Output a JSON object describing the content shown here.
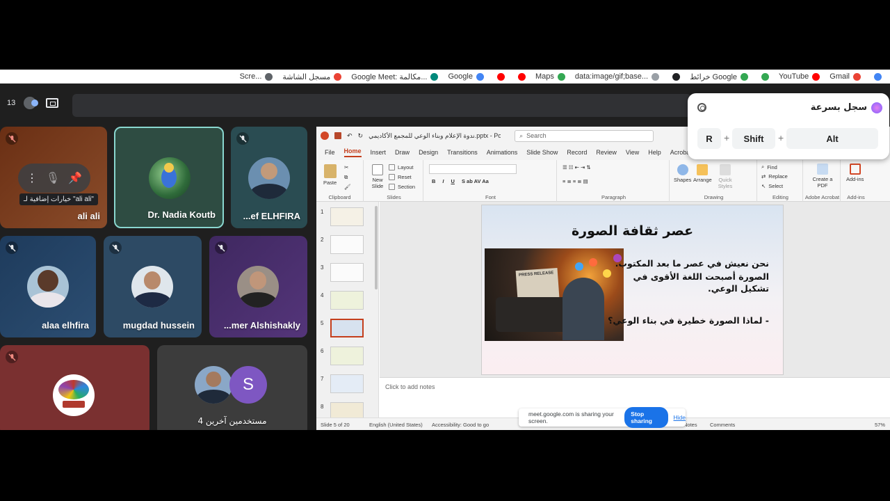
{
  "bookmarks": [
    {
      "label": "Scre...",
      "color": "#5f6368"
    },
    {
      "label": "مسجل الشاشة",
      "color": "#ea4335"
    },
    {
      "label": "Google Meet: مكالمة...",
      "color": "#00897b"
    },
    {
      "label": "Google",
      "color": "#4285f4"
    },
    {
      "label": "",
      "color": "#ff0000"
    },
    {
      "label": "",
      "color": "#ff0000"
    },
    {
      "label": "Maps",
      "color": "#34a853"
    },
    {
      "label": "data:image/gif;base...",
      "color": "#9aa0a6"
    },
    {
      "label": "",
      "color": "#202124"
    },
    {
      "label": "خرائط Google",
      "color": "#34a853"
    },
    {
      "label": "",
      "color": "#34a853"
    },
    {
      "label": "YouTube",
      "color": "#ff0000"
    },
    {
      "label": "Gmail",
      "color": "#ea4335"
    },
    {
      "label": "",
      "color": "#4285f4"
    }
  ],
  "meet": {
    "participant_count": "13"
  },
  "tiles": [
    {
      "name": "ali ali",
      "bg": "#7a3d1c",
      "tooltip": "خيارات إضافية لـ \"ali ali\""
    },
    {
      "name": "Dr. Nadia Koutb",
      "bg": "#2e4c42"
    },
    {
      "name": "...ef ELHFIRA",
      "bg": "#2a4c52"
    },
    {
      "name": "alaa elhfira",
      "bg": "#234263"
    },
    {
      "name": "mugdad hussein",
      "bg": "#2d4a64"
    },
    {
      "name": "...mer Alshishakly",
      "bg": "#4a2f6a"
    },
    {
      "name": "",
      "bg": "#7a3030"
    },
    {
      "name": "4 مستخدمين آخرين",
      "bg": "#3c3c3c",
      "avatar_letter": "S"
    }
  ],
  "ppt": {
    "filename": "ندوة الإعلام وبناء الوعي للمجمع الأكاديمي.pptx  -  PowerP...",
    "search_placeholder": "Search",
    "tabs": [
      "File",
      "Home",
      "Insert",
      "Draw",
      "Design",
      "Transitions",
      "Animations",
      "Slide Show",
      "Record",
      "Review",
      "View",
      "Help",
      "Acrobat"
    ],
    "ribbon": {
      "clipboard": {
        "paste": "Paste",
        "group": "Clipboard"
      },
      "slides": {
        "new_slide": "New Slide",
        "layout": "Layout",
        "reset": "Reset",
        "section": "Section",
        "group": "Slides"
      },
      "font_group": "Font",
      "paragraph_group": "Paragraph",
      "drawing": {
        "shapes": "Shapes",
        "arrange": "Arrange",
        "quick_styles": "Quick Styles",
        "group": "Drawing"
      },
      "editing": {
        "find": "Find",
        "replace": "Replace",
        "select": "Select",
        "group": "Editing"
      },
      "acrobat": {
        "create_pdf": "Create a PDF",
        "group": "Adobe Acrobat"
      },
      "addins": {
        "label": "Add-ins",
        "group": "Add-ins"
      }
    },
    "thumbnails": [
      "1",
      "2",
      "3",
      "4",
      "5",
      "6",
      "7",
      "8"
    ],
    "selected_slide": 5,
    "slide": {
      "title": "عصر ثقافة الصورة",
      "image_caption": "PRESS RELEASE",
      "line1": "نحن نعيش في عصر ما بعد المكتوب.",
      "line2": "الصورة أصبحت اللغة الأقوى في تشكيل الوعي.",
      "line3": "- لماذا الصورة خطيرة في بناء الوعي؟"
    },
    "notes_placeholder": "Click to add notes",
    "status": {
      "slide_of": "Slide 5 of 20",
      "language": "English (United States)",
      "accessibility": "Accessibility: Good to go",
      "notes": "Notes",
      "comments": "Comments",
      "zoom": "57%"
    }
  },
  "share_banner": {
    "text": "meet.google.com is sharing your screen.",
    "stop": "Stop sharing",
    "hide": "Hide"
  },
  "shortcut": {
    "title": "سجل بسرعة",
    "keys": [
      "R",
      "Shift",
      "Alt"
    ]
  }
}
